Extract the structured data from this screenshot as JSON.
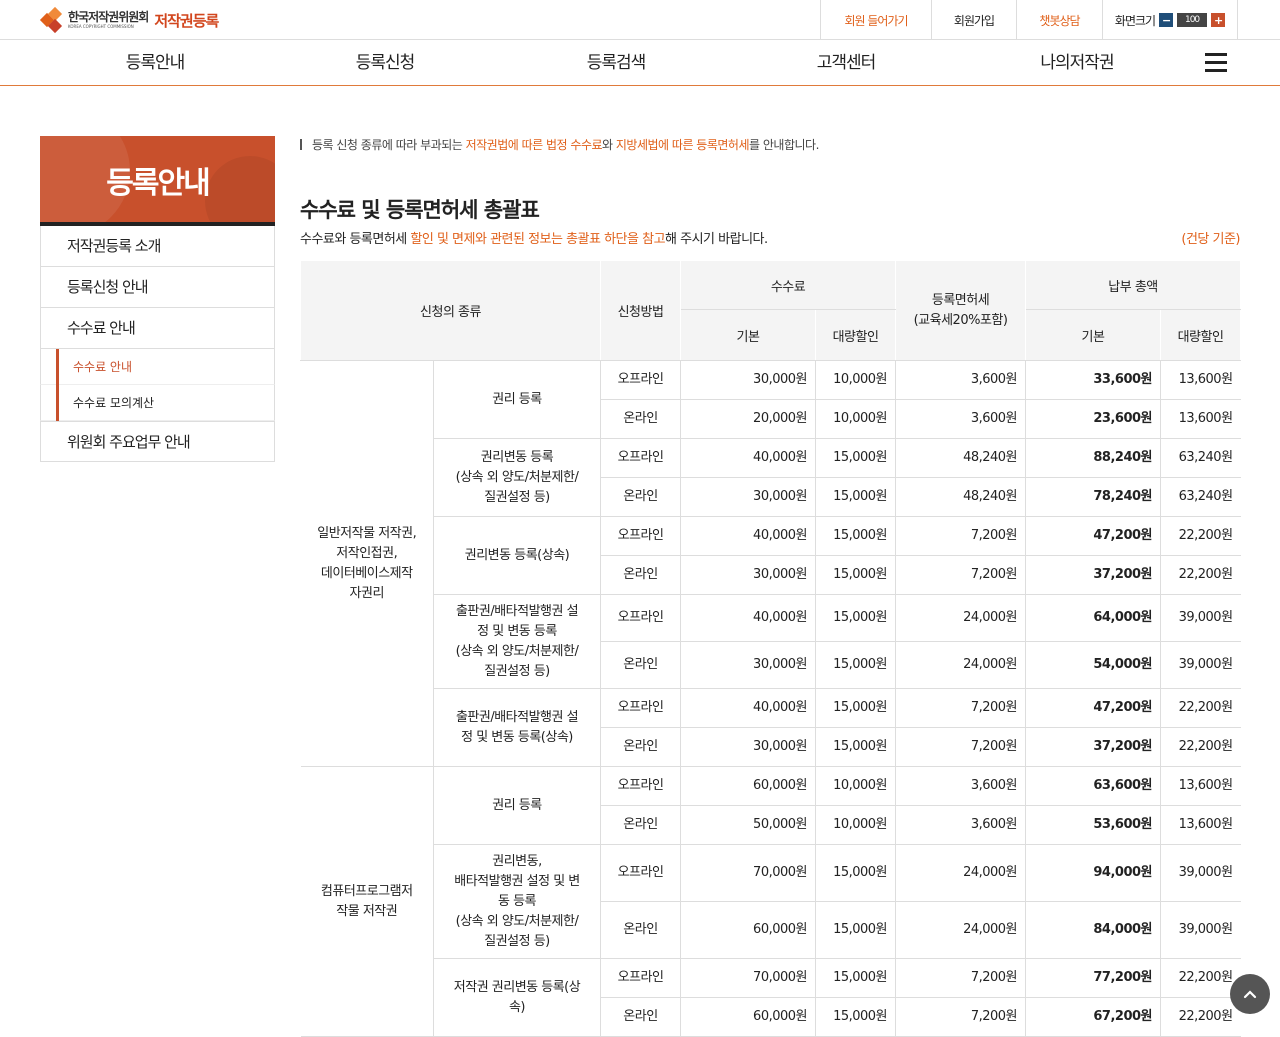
{
  "header": {
    "logo_kr": "한국저작권위원회",
    "logo_en": "KOREA COPYRIGHT COMMISSION",
    "logo_sub": "저작권등록",
    "util": {
      "login": "회원 들어가기",
      "signup": "회원가입",
      "chatbot": "챗봇상담",
      "zoom_label": "화면크기",
      "zoom_value": "100"
    },
    "accent_color": "#e0601a"
  },
  "gnb": [
    "등록안내",
    "등록신청",
    "등록검색",
    "고객센터",
    "나의저작권"
  ],
  "lnb": {
    "title": "등록안내",
    "items": [
      "저작권등록 소개",
      "등록신청 안내",
      "수수료 안내",
      "위원회 주요업무 안내"
    ],
    "sub_items": [
      "수수료 안내",
      "수수료 모의계산"
    ]
  },
  "content": {
    "intro_1": "등록 신청 종류에 따라 부과되는 ",
    "intro_2": "저작권법에 따른 법정 수수료",
    "intro_3": "와 ",
    "intro_4": "지방세법에 따른 등록면허세",
    "intro_5": "를 안내합니다.",
    "title": "수수료 및 등록면허세 총괄표",
    "desc_1": "수수료와 등록면허세 ",
    "desc_2": "할인 및 면제와 관련된 정보는 총괄표 하단을 참고",
    "desc_3": "해 주시기 바랍니다.",
    "basis": "(건당 기준)"
  },
  "table": {
    "headers": {
      "type": "신청의 종류",
      "method": "신청방법",
      "fee": "수수료",
      "tax": "등록면허세\n(교육세20%포함)",
      "total": "납부 총액",
      "basic": "기본",
      "bulk": "대량할인"
    },
    "groups": [
      {
        "category": "일반저작물 저작권,\n저작인접권,\n데이터베이스제작\n자권리",
        "kinds": [
          {
            "name": "권리 등록",
            "rows": [
              [
                "오프라인",
                "30,000원",
                "10,000원",
                "3,600원",
                "33,600원",
                "13,600원"
              ],
              [
                "온라인",
                "20,000원",
                "10,000원",
                "3,600원",
                "23,600원",
                "13,600원"
              ]
            ]
          },
          {
            "name": "권리변동 등록\n(상속 외 양도/처분제한/\n질권설정 등)",
            "rows": [
              [
                "오프라인",
                "40,000원",
                "15,000원",
                "48,240원",
                "88,240원",
                "63,240원"
              ],
              [
                "온라인",
                "30,000원",
                "15,000원",
                "48,240원",
                "78,240원",
                "63,240원"
              ]
            ]
          },
          {
            "name": "권리변동 등록(상속)",
            "rows": [
              [
                "오프라인",
                "40,000원",
                "15,000원",
                "7,200원",
                "47,200원",
                "22,200원"
              ],
              [
                "온라인",
                "30,000원",
                "15,000원",
                "7,200원",
                "37,200원",
                "22,200원"
              ]
            ]
          },
          {
            "name": "출판권/배타적발행권 설\n정 및 변동 등록\n(상속 외 양도/처분제한/\n질권설정 등)",
            "rows": [
              [
                "오프라인",
                "40,000원",
                "15,000원",
                "24,000원",
                "64,000원",
                "39,000원"
              ],
              [
                "온라인",
                "30,000원",
                "15,000원",
                "24,000원",
                "54,000원",
                "39,000원"
              ]
            ]
          },
          {
            "name": "출판권/배타적발행권 설\n정 및 변동 등록(상속)",
            "rows": [
              [
                "오프라인",
                "40,000원",
                "15,000원",
                "7,200원",
                "47,200원",
                "22,200원"
              ],
              [
                "온라인",
                "30,000원",
                "15,000원",
                "7,200원",
                "37,200원",
                "22,200원"
              ]
            ]
          }
        ]
      },
      {
        "category": "컴퓨터프로그램저\n작물 저작권",
        "kinds": [
          {
            "name": "권리 등록",
            "rows": [
              [
                "오프라인",
                "60,000원",
                "10,000원",
                "3,600원",
                "63,600원",
                "13,600원"
              ],
              [
                "온라인",
                "50,000원",
                "10,000원",
                "3,600원",
                "53,600원",
                "13,600원"
              ]
            ]
          },
          {
            "name": "권리변동,\n배타적발행권 설정 및 변\n동 등록\n(상속 외 양도/처분제한/\n질권설정 등)",
            "rows": [
              [
                "오프라인",
                "70,000원",
                "15,000원",
                "24,000원",
                "94,000원",
                "39,000원"
              ],
              [
                "온라인",
                "60,000원",
                "15,000원",
                "24,000원",
                "84,000원",
                "39,000원"
              ]
            ]
          },
          {
            "name": "저작권 권리변동 등록(상\n속)",
            "rows": [
              [
                "오프라인",
                "70,000원",
                "15,000원",
                "7,200원",
                "77,200원",
                "22,200원"
              ],
              [
                "온라인",
                "60,000원",
                "15,000원",
                "7,200원",
                "67,200원",
                "22,200원"
              ]
            ]
          }
        ]
      }
    ]
  }
}
